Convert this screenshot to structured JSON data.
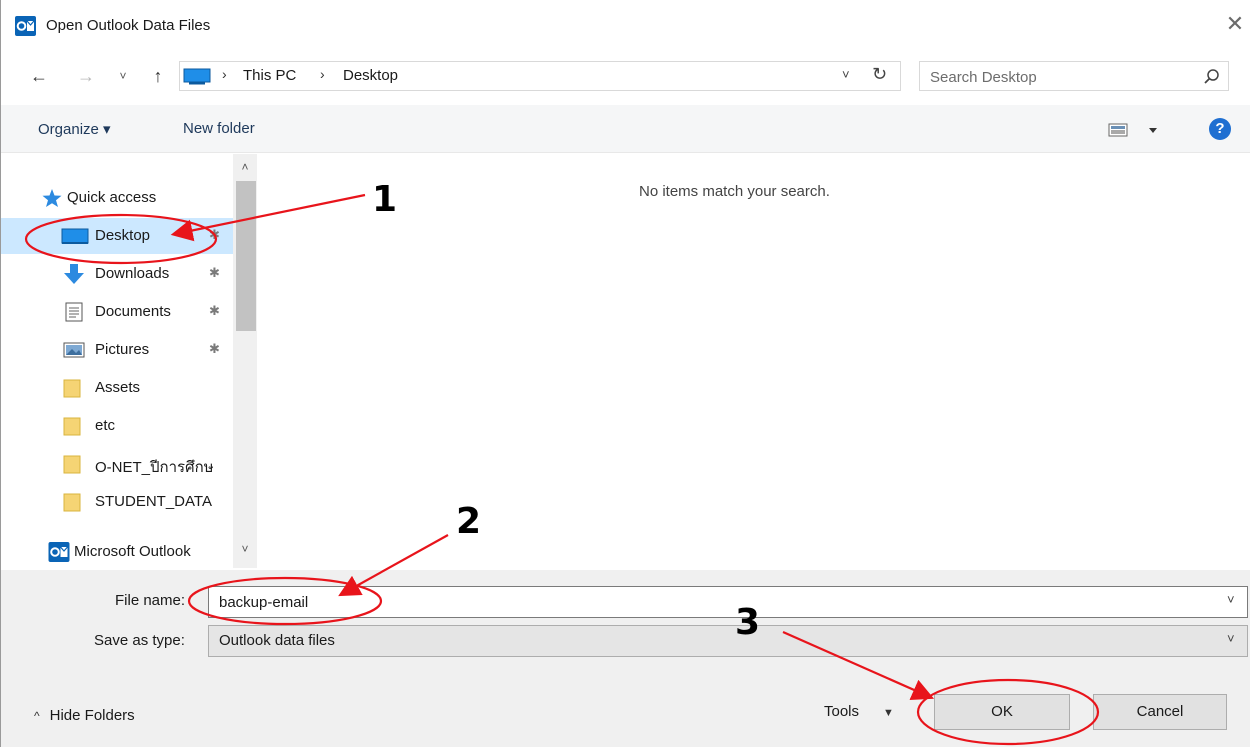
{
  "window": {
    "title": "Open Outlook Data Files",
    "close_glyph": "✕"
  },
  "nav": {
    "back_glyph": "←",
    "forward_glyph": "→",
    "recent_glyph": "˅",
    "up_glyph": "↑",
    "address": {
      "sep": "›",
      "crumbs": [
        "This PC",
        "Desktop"
      ],
      "dropdown_glyph": "˅",
      "refresh_glyph": "↻"
    },
    "search": {
      "placeholder": "Search Desktop"
    }
  },
  "toolbar": {
    "organize_label": "Organize ▾",
    "newfolder_label": "New folder",
    "help_label": "?"
  },
  "sidebar": {
    "items": [
      {
        "label": "Quick access",
        "icon": "star-icon"
      },
      {
        "label": "Desktop",
        "icon": "desktop-icon",
        "selected": true,
        "pin": "✱"
      },
      {
        "label": "Downloads",
        "icon": "download-icon",
        "pin": "✱"
      },
      {
        "label": "Documents",
        "icon": "documents-icon",
        "pin": "✱"
      },
      {
        "label": "Pictures",
        "icon": "pictures-icon",
        "pin": "✱"
      },
      {
        "label": "Assets",
        "icon": "folder-icon"
      },
      {
        "label": "etc",
        "icon": "folder-icon"
      },
      {
        "label": "O-NET_ปีการศึกษ",
        "icon": "folder-icon"
      },
      {
        "label": "STUDENT_DATA",
        "icon": "folder-icon"
      },
      {
        "label": "Microsoft Outlook",
        "icon": "outlook-icon"
      }
    ],
    "scroll_up_glyph": "˄",
    "scroll_down_glyph": "˅"
  },
  "content": {
    "empty_message": "No items match your search."
  },
  "bottom": {
    "file_name_label": "File name:",
    "file_name_value": "backup-email",
    "save_type_label": "Save as type:",
    "save_type_value": "Outlook data files",
    "chevron_glyph": "˅",
    "hide_folders_label": "Hide Folders",
    "hide_folders_caret": "^",
    "tools_label": "Tools",
    "tools_caret": "▼",
    "ok_label": "OK",
    "cancel_label": "Cancel"
  },
  "annotations": {
    "steps": [
      "1",
      "2",
      "3"
    ],
    "color": "#e8141b"
  },
  "colors": {
    "accent": "#1f6fd1",
    "selection": "#cce8ff",
    "outlook_blue": "#0a64b6",
    "folder": "#f5d474"
  }
}
